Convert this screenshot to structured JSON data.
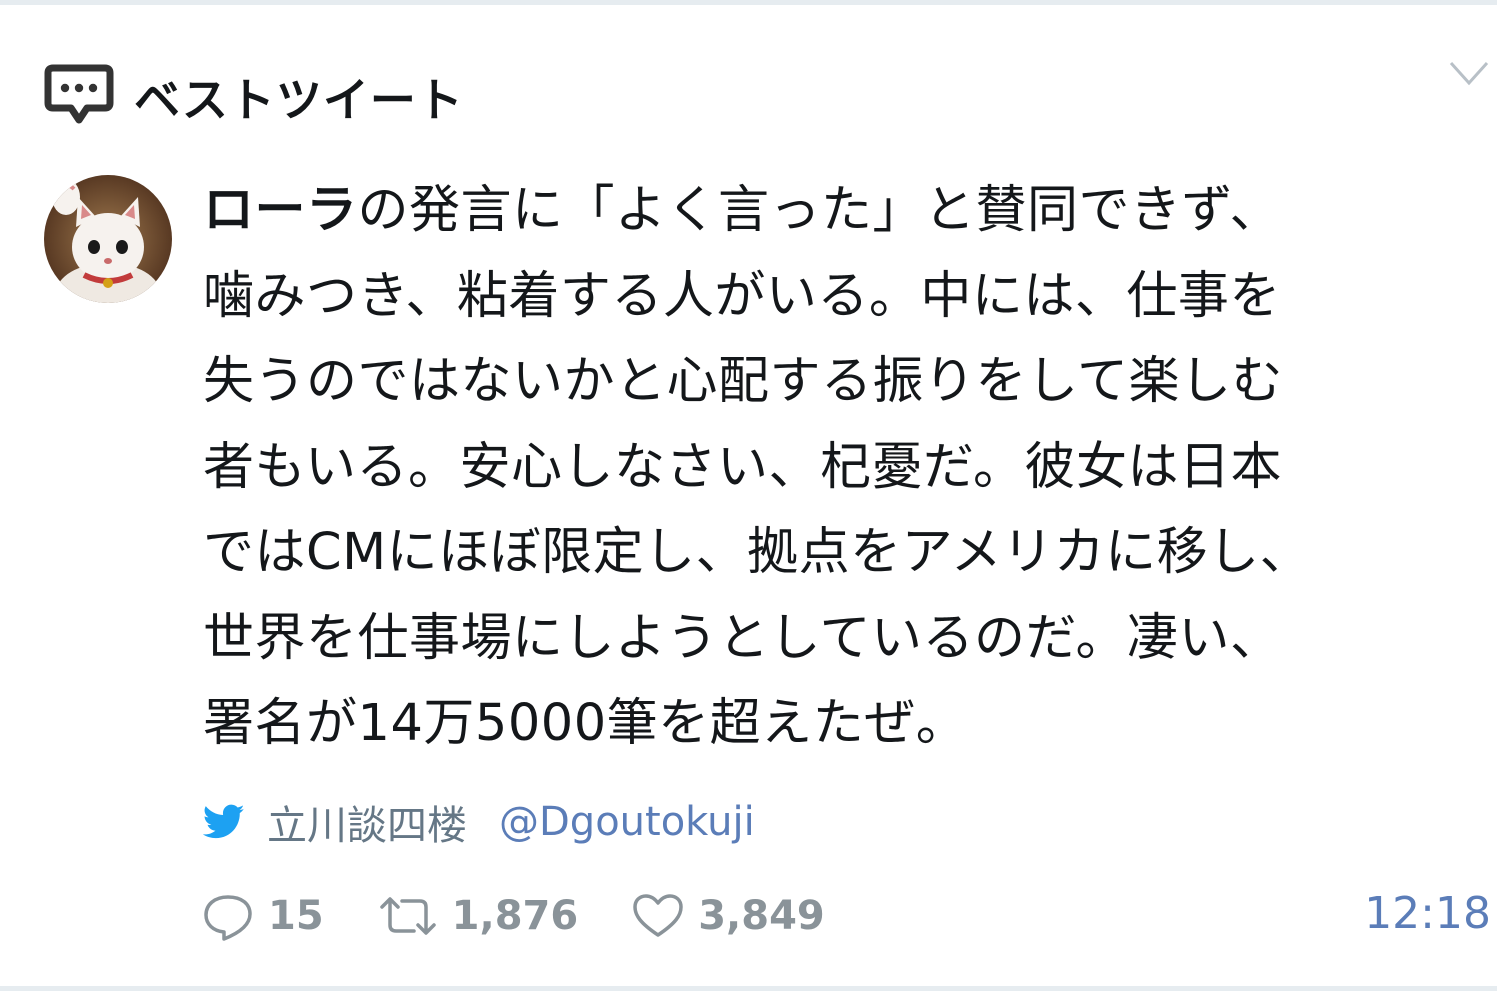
{
  "header": {
    "title": "ベストツイート"
  },
  "tweet": {
    "lines": [
      {
        "bold": "ローラ",
        "text": "の発言に「よく言った」と賛同できず、"
      },
      {
        "text": "噛みつき、粘着する人がいる。中には、仕事を"
      },
      {
        "text": "失うのではないかと心配する振りをして楽しむ"
      },
      {
        "text": "者もいる。安心しなさい、杞憂だ。彼女は日本"
      },
      {
        "text": "ではCMにほぼ限定し、拠点をアメリカに移し、"
      },
      {
        "text": "世界を仕事場にしようとしているのだ。凄い、"
      },
      {
        "text": "署名が14万5000筆を超えたぜ。"
      }
    ],
    "author_name": "立川談四楼",
    "author_handle": "@Dgoutokuji",
    "reply_count": "15",
    "retweet_count": "1,876",
    "like_count": "3,849",
    "time": "12:18"
  },
  "icons": {
    "header": "speech-bubble-icon",
    "menu": "chevron-down-icon",
    "source": "twitter-bird-icon",
    "reply": "reply-icon",
    "retweet": "retweet-icon",
    "like": "heart-icon"
  },
  "colors": {
    "text": "#14171a",
    "muted": "#657786",
    "link": "#5b7db8",
    "twitter_blue": "#1da1f2"
  }
}
